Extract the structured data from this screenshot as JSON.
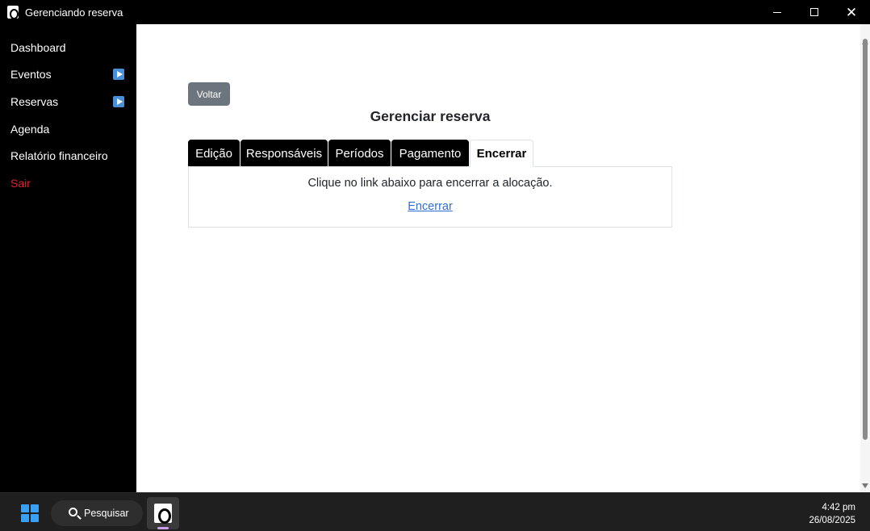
{
  "window": {
    "title": "Gerenciando reserva",
    "minimize_label": "",
    "maximize_label": "",
    "close_label": "✕"
  },
  "sidebar": {
    "items": [
      {
        "label": "Dashboard",
        "has_submenu": false
      },
      {
        "label": "Eventos",
        "has_submenu": true
      },
      {
        "label": "Reservas",
        "has_submenu": true
      },
      {
        "label": "Agenda",
        "has_submenu": false
      },
      {
        "label": "Relatório financeiro",
        "has_submenu": false
      },
      {
        "label": "Sair",
        "has_submenu": false
      }
    ]
  },
  "main": {
    "back_label": "Voltar",
    "title": "Gerenciar reserva",
    "tabs": [
      {
        "label": "Edição",
        "active": false
      },
      {
        "label": "Responsáveis",
        "active": false
      },
      {
        "label": "Períodos",
        "active": false
      },
      {
        "label": "Pagamento",
        "active": false
      },
      {
        "label": "Encerrar",
        "active": true
      }
    ],
    "panel": {
      "text": "Clique no link abaixo para encerrar a alocação.",
      "link": "Encerrar"
    }
  },
  "taskbar": {
    "search_label": "Pesquisar",
    "time": "4:42 pm",
    "date": "26/08/2025"
  },
  "colors": {
    "sidebar_bg": "#000000",
    "danger": "#e3202e",
    "back_button": "#6c757d",
    "link": "#2f6fd6",
    "submenu_icon": "#4a90d9"
  }
}
